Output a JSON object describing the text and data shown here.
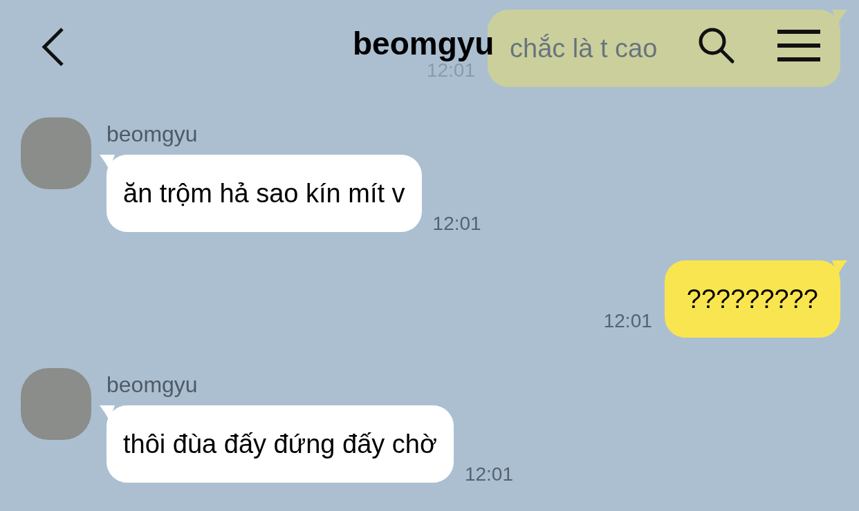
{
  "header": {
    "title": "beomgyu"
  },
  "messages": [
    {
      "kind": "sent",
      "text": "chắc là t cao",
      "time": "12:01"
    },
    {
      "kind": "received",
      "sender": "beomgyu",
      "text": "ăn trộm hả sao kín mít v",
      "time": "12:01"
    },
    {
      "kind": "sent",
      "text": "?????????",
      "time": "12:01"
    },
    {
      "kind": "received",
      "sender": "beomgyu",
      "text": "thôi đùa đấy đứng đấy chờ",
      "time": "12:01"
    }
  ]
}
